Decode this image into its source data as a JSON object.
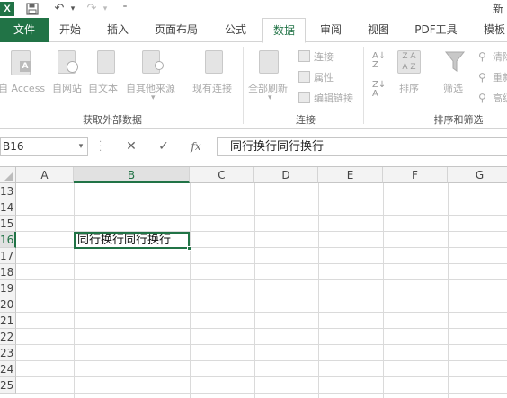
{
  "titlebar": {
    "title_fragment": "新"
  },
  "tabs": [
    "文件",
    "开始",
    "插入",
    "页面布局",
    "公式",
    "数据",
    "审阅",
    "视图",
    "PDF工具",
    "模板"
  ],
  "ribbon": {
    "get_external": {
      "access": "自 Access",
      "web": "自网站",
      "text": "自文本",
      "other": "自其他来源",
      "existing": "现有连接",
      "group_label": "获取外部数据"
    },
    "connections": {
      "refresh_all": "全部刷新",
      "connections": "连接",
      "properties": "属性",
      "edit_links": "编辑链接",
      "group_label": "连接"
    },
    "sort_filter": {
      "sort": "排序",
      "filter": "筛选",
      "clear": "清除",
      "reapply": "重新应用",
      "advanced": "高级",
      "group_label": "排序和筛选"
    }
  },
  "formula_bar": {
    "name_box": "B16",
    "cancel": "✕",
    "enter": "✓",
    "fx": "fx",
    "content": "同行换行同行换行"
  },
  "grid": {
    "columns": [
      "A",
      "B",
      "C",
      "D",
      "E",
      "F",
      "G"
    ],
    "rows": [
      "13",
      "14",
      "15",
      "16",
      "17",
      "18",
      "19",
      "20",
      "21",
      "22",
      "23",
      "24",
      "25"
    ],
    "active_cell": "B16",
    "active_cell_value": "同行换行同行换行"
  },
  "colors": {
    "accent": "#217346"
  }
}
